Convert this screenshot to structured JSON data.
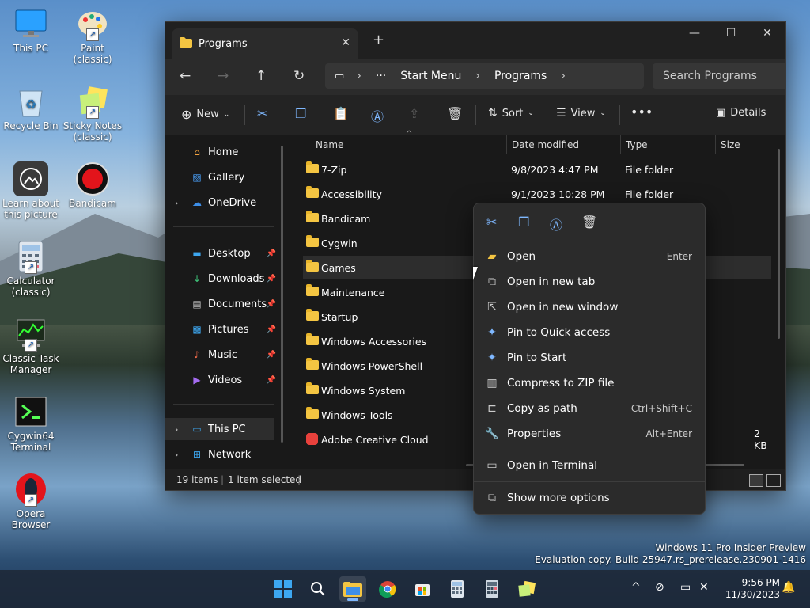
{
  "desktop": {
    "icons": [
      {
        "label": "This PC"
      },
      {
        "label": "Paint (classic)"
      },
      {
        "label": "Recycle Bin"
      },
      {
        "label": "Sticky Notes (classic)"
      },
      {
        "label": "Learn about this picture"
      },
      {
        "label": "Bandicam"
      },
      {
        "label": "Calculator (classic)"
      },
      {
        "label": "Classic Task Manager"
      },
      {
        "label": "Cygwin64 Terminal"
      },
      {
        "label": "Opera Browser"
      }
    ]
  },
  "window": {
    "tab_title": "Programs",
    "address": [
      "Start Menu",
      "Programs"
    ],
    "search_placeholder": "Search Programs",
    "toolbar": {
      "new": "New",
      "sort": "Sort",
      "view": "View",
      "details": "Details"
    },
    "sidebar": {
      "top": [
        {
          "label": "Home",
          "icon": "home-icon"
        },
        {
          "label": "Gallery",
          "icon": "gallery-icon"
        },
        {
          "label": "OneDrive",
          "icon": "cloud-icon"
        }
      ],
      "quick": [
        {
          "label": "Desktop",
          "icon": "desktop-icon"
        },
        {
          "label": "Downloads",
          "icon": "download-icon"
        },
        {
          "label": "Documents",
          "icon": "documents-icon"
        },
        {
          "label": "Pictures",
          "icon": "pictures-icon"
        },
        {
          "label": "Music",
          "icon": "music-icon"
        },
        {
          "label": "Videos",
          "icon": "videos-icon"
        }
      ],
      "bottom": [
        {
          "label": "This PC",
          "icon": "pc-icon"
        },
        {
          "label": "Network",
          "icon": "network-icon"
        }
      ]
    },
    "columns": [
      "Name",
      "Date modified",
      "Type",
      "Size"
    ],
    "rows": [
      {
        "name": "7-Zip",
        "date": "9/8/2023 4:47 PM",
        "type": "File folder",
        "size": ""
      },
      {
        "name": "Accessibility",
        "date": "9/1/2023 10:28 PM",
        "type": "File folder",
        "size": ""
      },
      {
        "name": "Bandicam",
        "date": "",
        "type": "",
        "size": ""
      },
      {
        "name": "Cygwin",
        "date": "",
        "type": "",
        "size": ""
      },
      {
        "name": "Games",
        "date": "",
        "type": "",
        "size": ""
      },
      {
        "name": "Maintenance",
        "date": "",
        "type": "",
        "size": ""
      },
      {
        "name": "Startup",
        "date": "",
        "type": "",
        "size": ""
      },
      {
        "name": "Windows Accessories",
        "date": "",
        "type": "",
        "size": ""
      },
      {
        "name": "Windows PowerShell",
        "date": "",
        "type": "",
        "size": ""
      },
      {
        "name": "Windows System",
        "date": "",
        "type": "",
        "size": ""
      },
      {
        "name": "Windows Tools",
        "date": "",
        "type": "",
        "size": ""
      },
      {
        "name": "Adobe Creative Cloud",
        "date": "",
        "type": "",
        "size": "2 KB"
      }
    ],
    "status": {
      "count": "19 items",
      "selected": "1 item selected"
    }
  },
  "context_menu": {
    "items": [
      {
        "label": "Open",
        "shortcut": "Enter",
        "icon": "folder-open-icon"
      },
      {
        "label": "Open in new tab",
        "shortcut": "",
        "icon": "new-tab-icon"
      },
      {
        "label": "Open in new window",
        "shortcut": "",
        "icon": "new-window-icon"
      },
      {
        "label": "Pin to Quick access",
        "shortcut": "",
        "icon": "pin-icon"
      },
      {
        "label": "Pin to Start",
        "shortcut": "",
        "icon": "pin-start-icon"
      },
      {
        "label": "Compress to ZIP file",
        "shortcut": "",
        "icon": "zip-icon"
      },
      {
        "label": "Copy as path",
        "shortcut": "Ctrl+Shift+C",
        "icon": "copy-path-icon"
      },
      {
        "label": "Properties",
        "shortcut": "Alt+Enter",
        "icon": "wrench-icon"
      }
    ],
    "terminal": "Open in Terminal",
    "more": "Show more options"
  },
  "watermark": {
    "line1": "Windows 11 Pro Insider Preview",
    "line2": "Evaluation copy. Build 25947.rs_prerelease.230901-1416"
  },
  "clock": {
    "time": "9:56 PM",
    "date": "11/30/2023"
  },
  "colors": {
    "accent": "#7fb8ff",
    "folder": "#f4c542",
    "window_bg": "#191919"
  }
}
